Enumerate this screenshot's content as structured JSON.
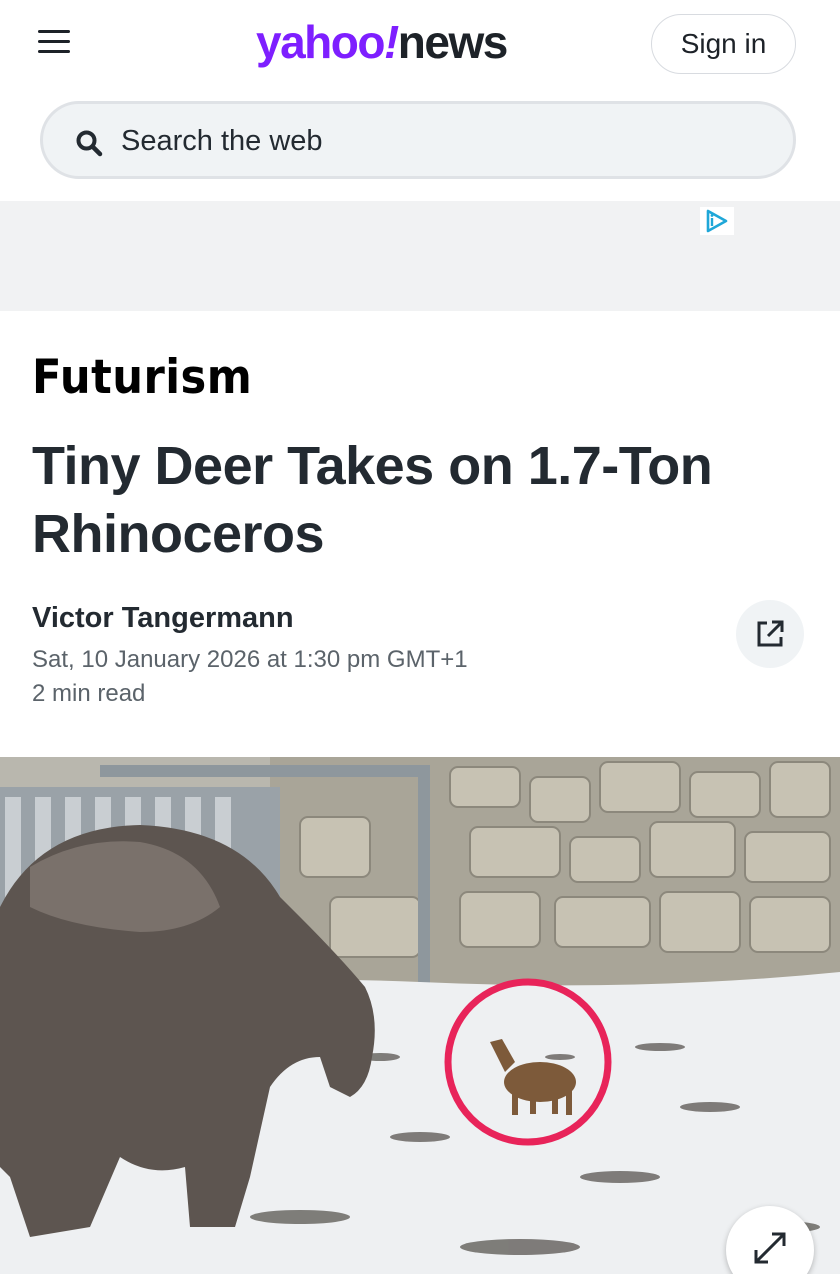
{
  "header": {
    "menu_icon": "hamburger-menu-icon",
    "logo": {
      "yahoo": "yahoo",
      "bang": "!",
      "news": "news",
      "brand_color": "#7e1fff"
    },
    "signin_label": "Sign in"
  },
  "search": {
    "icon": "search-icon",
    "placeholder": "Search the web"
  },
  "ad": {
    "badge_icon": "adchoices-icon"
  },
  "article": {
    "source": "Futurism",
    "title": "Tiny Deer Takes on 1.7-Ton Rhinoceros",
    "author": "Victor Tangermann",
    "date": "Sat, 10 January 2026 at 1:30 pm GMT+1",
    "read_time": "2 min read",
    "share_icon": "external-share-icon"
  },
  "media": {
    "image_subject": "rhinoceros and small deer in snowy zoo enclosure",
    "highlight_color": "#e8245a",
    "expand_icon": "expand-arrows-icon"
  }
}
